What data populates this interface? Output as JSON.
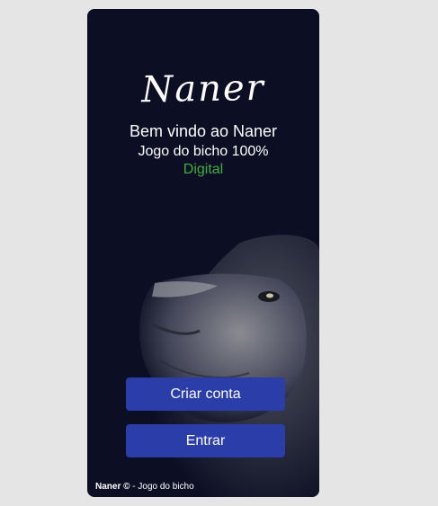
{
  "app": {
    "logo_text": "Naner",
    "welcome": "Bem vindo ao Naner",
    "tagline": "Jogo do bicho 100%",
    "highlight": "Digital"
  },
  "actions": {
    "create_account": "Criar conta",
    "login": "Entrar"
  },
  "footer": {
    "brand": "Naner ©",
    "separator": "-",
    "text": "Jogo do bicho"
  },
  "colors": {
    "background": "#0c0f24",
    "button": "#2a3da9",
    "accent_green": "#3fae3f",
    "page": "#e5e5e5"
  },
  "image": {
    "name": "lion-image"
  }
}
